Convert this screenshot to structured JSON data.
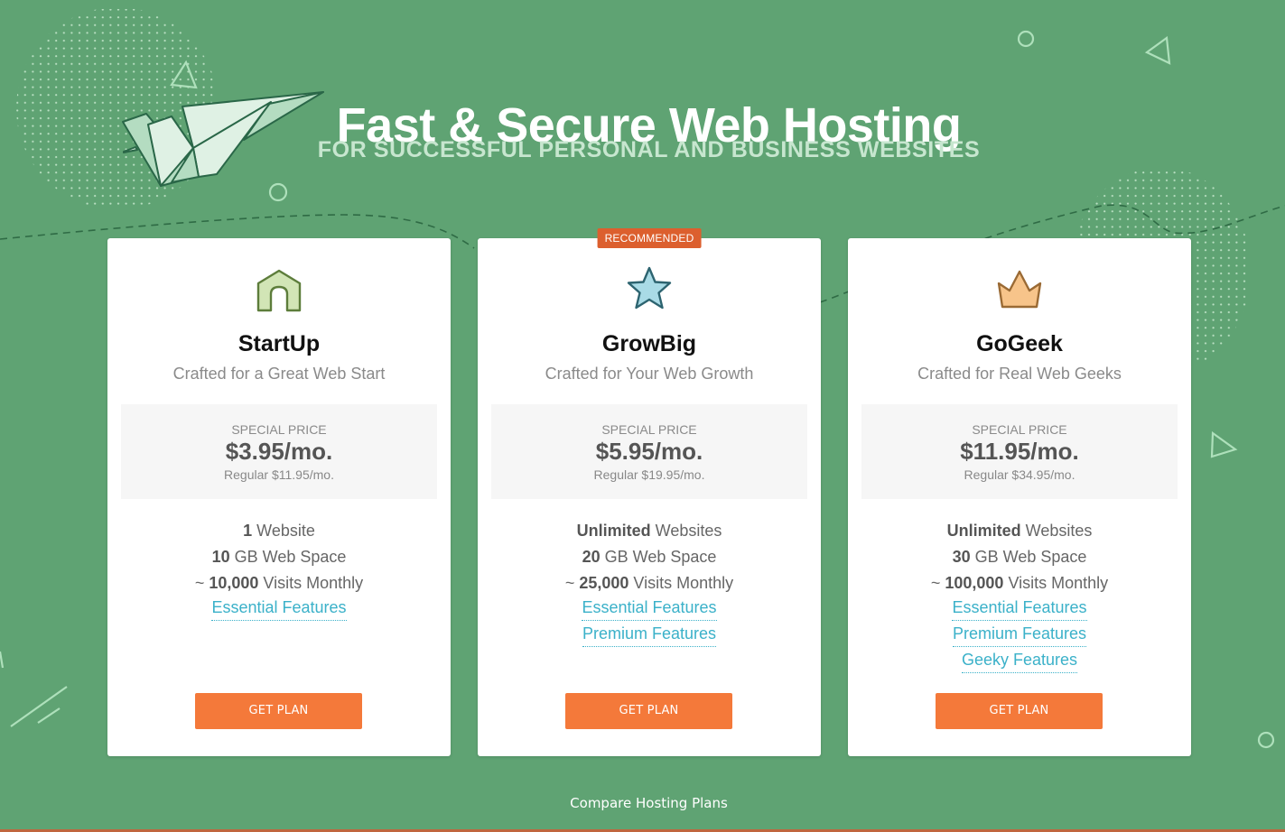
{
  "hero": {
    "title": "Fast & Secure Web Hosting",
    "subtitle": "FOR SUCCESSFUL PERSONAL AND BUSINESS WEBSITES"
  },
  "colors": {
    "background": "#5fa373",
    "accent_button": "#f4793a",
    "badge": "#dc5f2e",
    "link": "#3bb1c9"
  },
  "plans": [
    {
      "icon": "house-icon",
      "name": "StartUp",
      "tagline": "Crafted for a Great Web Start",
      "price_label": "SPECIAL PRICE",
      "price": "$3.95/mo.",
      "regular_price": "Regular $11.95/mo.",
      "features": [
        {
          "bold": "1",
          "text": " Website"
        },
        {
          "bold": "10",
          "text": " GB Web Space"
        },
        {
          "prefix": "~ ",
          "bold": "10,000",
          "text": " Visits Monthly"
        }
      ],
      "links": [
        "Essential Features"
      ],
      "button": "GET PLAN"
    },
    {
      "badge": "RECOMMENDED",
      "icon": "star-icon",
      "name": "GrowBig",
      "tagline": "Crafted for Your Web Growth",
      "price_label": "SPECIAL PRICE",
      "price": "$5.95/mo.",
      "regular_price": "Regular $19.95/mo.",
      "features": [
        {
          "bold": "Unlimited",
          "text": " Websites"
        },
        {
          "bold": "20",
          "text": " GB Web Space"
        },
        {
          "prefix": "~ ",
          "bold": "25,000",
          "text": " Visits Monthly"
        }
      ],
      "links": [
        "Essential Features",
        "Premium Features"
      ],
      "button": "GET PLAN"
    },
    {
      "icon": "crown-icon",
      "name": "GoGeek",
      "tagline": "Crafted for Real Web Geeks",
      "price_label": "SPECIAL PRICE",
      "price": "$11.95/mo.",
      "regular_price": "Regular $34.95/mo.",
      "features": [
        {
          "bold": "Unlimited",
          "text": " Websites"
        },
        {
          "bold": "30",
          "text": " GB Web Space"
        },
        {
          "prefix": "~ ",
          "bold": "100,000",
          "text": " Visits Monthly"
        }
      ],
      "links": [
        "Essential Features",
        "Premium Features",
        "Geeky Features"
      ],
      "button": "GET PLAN"
    }
  ],
  "footer": {
    "compare_link": "Compare Hosting Plans"
  }
}
